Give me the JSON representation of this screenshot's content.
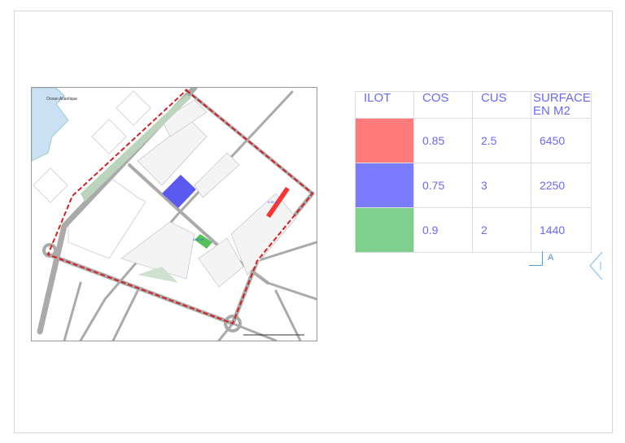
{
  "map": {
    "ocean_label": "Ocean Atlantique",
    "plot_labels": [
      "0.54 m²",
      "0.50 m²"
    ]
  },
  "table": {
    "headers": [
      "ILOT",
      "COS",
      "CUS",
      "SURFACE EN M2"
    ],
    "rows": [
      {
        "color": "#ff7b7b",
        "cos": "0.85",
        "cus": "2.5",
        "surface": "6450"
      },
      {
        "color": "#7b7bff",
        "cos": "0.75",
        "cus": "3",
        "surface": "2250"
      },
      {
        "color": "#7fcf8e",
        "cos": "0.9",
        "cus": "2",
        "surface": "1440"
      }
    ]
  },
  "section_marker": "A"
}
